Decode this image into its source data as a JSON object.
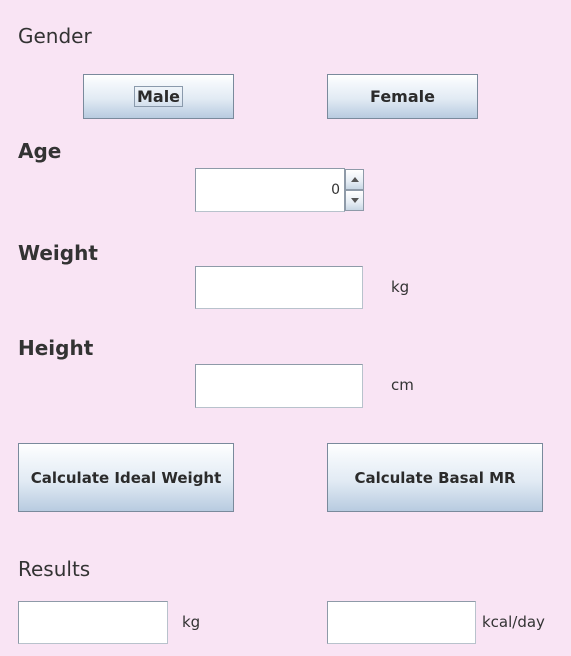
{
  "gender": {
    "label": "Gender",
    "male_label": "Male",
    "female_label": "Female"
  },
  "age": {
    "label": "Age",
    "value": "0"
  },
  "weight": {
    "label": "Weight",
    "value": "",
    "unit": "kg"
  },
  "height": {
    "label": "Height",
    "value": "",
    "unit": "cm"
  },
  "actions": {
    "ideal_weight_label": "Calculate Ideal Weight",
    "basal_mr_label": "Calculate Basal MR"
  },
  "results": {
    "label": "Results",
    "weight_value": "",
    "weight_unit": "kg",
    "bmr_value": "",
    "bmr_unit": "kcal/day"
  },
  "colors": {
    "background": "#f9e4f4",
    "button_gradient_top": "#ffffff",
    "button_gradient_bottom": "#b8cbe0",
    "text": "#333333"
  }
}
